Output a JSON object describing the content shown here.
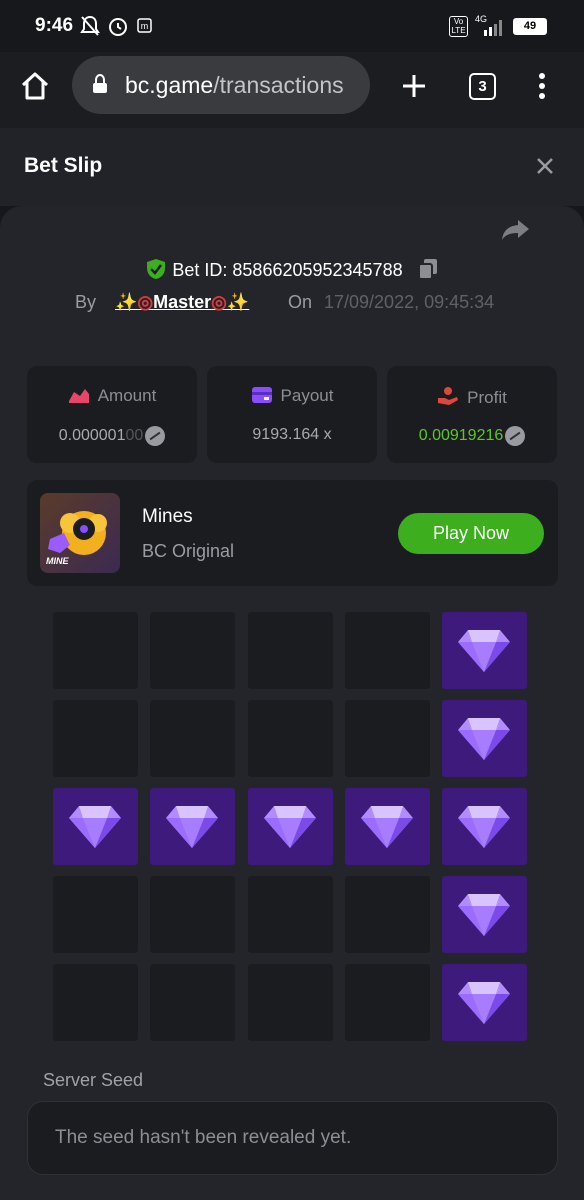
{
  "status_bar": {
    "time": "9:46",
    "network": "4G",
    "volte": "Vo LTE",
    "battery": "49"
  },
  "browser": {
    "url_domain": "bc.game",
    "url_path": "/transactions",
    "tab_count": "3"
  },
  "header": {
    "title": "Bet Slip"
  },
  "bet": {
    "id_label": "Bet ID: 85866205952345788",
    "by_label": "By",
    "user": "Master",
    "on_label": "On",
    "datetime": "17/09/2022, 09:45:34"
  },
  "stats": {
    "amount_label": "Amount",
    "amount_main": "0.000001",
    "amount_faded": "00",
    "payout_label": "Payout",
    "payout_value": "9193.164 x",
    "profit_label": "Profit",
    "profit_value": "0.00919216"
  },
  "game": {
    "name": "Mines",
    "subtitle": "BC Original",
    "thumb_text": "MINE",
    "play_label": "Play Now"
  },
  "mines_grid": [
    [
      false,
      false,
      false,
      false,
      true
    ],
    [
      false,
      false,
      false,
      false,
      true
    ],
    [
      true,
      true,
      true,
      true,
      true
    ],
    [
      false,
      false,
      false,
      false,
      true
    ],
    [
      false,
      false,
      false,
      false,
      true
    ]
  ],
  "seed": {
    "label": "Server Seed",
    "value": "The seed hasn't been revealed yet."
  },
  "colors": {
    "accent_green": "#3dae1e",
    "profit_green": "#5ac827",
    "gem_tile": "#3d1a7c",
    "amount_icon": "#e8456a",
    "payout_icon": "#8a4dff",
    "profit_icon": "#e0473c"
  }
}
